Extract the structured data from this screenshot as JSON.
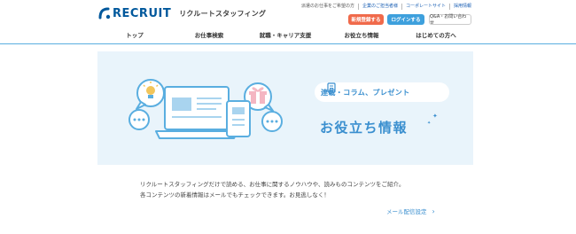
{
  "header": {
    "logo_text": "RECRUIT",
    "logo_sub": "リクルートスタッフィング",
    "top_links": [
      "派遣のお仕事をご希望の方",
      "企業のご担当者様",
      "コーポレートサイト",
      "採用情報"
    ],
    "register_label": "新規登録する",
    "login_label": "ログインする",
    "qa_label": "Q&A・お問い合わせ"
  },
  "nav": {
    "items": [
      "トップ",
      "お仕事検索",
      "就職・キャリア支援",
      "お役立ち情報",
      "はじめての方へ"
    ]
  },
  "hero": {
    "tag_label": "連載・コラム、プレゼント",
    "title": "お役立ち情報",
    "colors": {
      "accent": "#3a8fcf",
      "background": "#e9f4fb",
      "illustration": "#5aaee0"
    }
  },
  "content": {
    "desc_line1": "リクルートスタッフィングだけで読める、お仕事に関するノウハウや、読みものコンテンツをご紹介。",
    "desc_line2": "各コンテンツの新着情報はメールでもチェックできます。お見逃しなく！",
    "mail_link_label": "メール配信設定"
  }
}
